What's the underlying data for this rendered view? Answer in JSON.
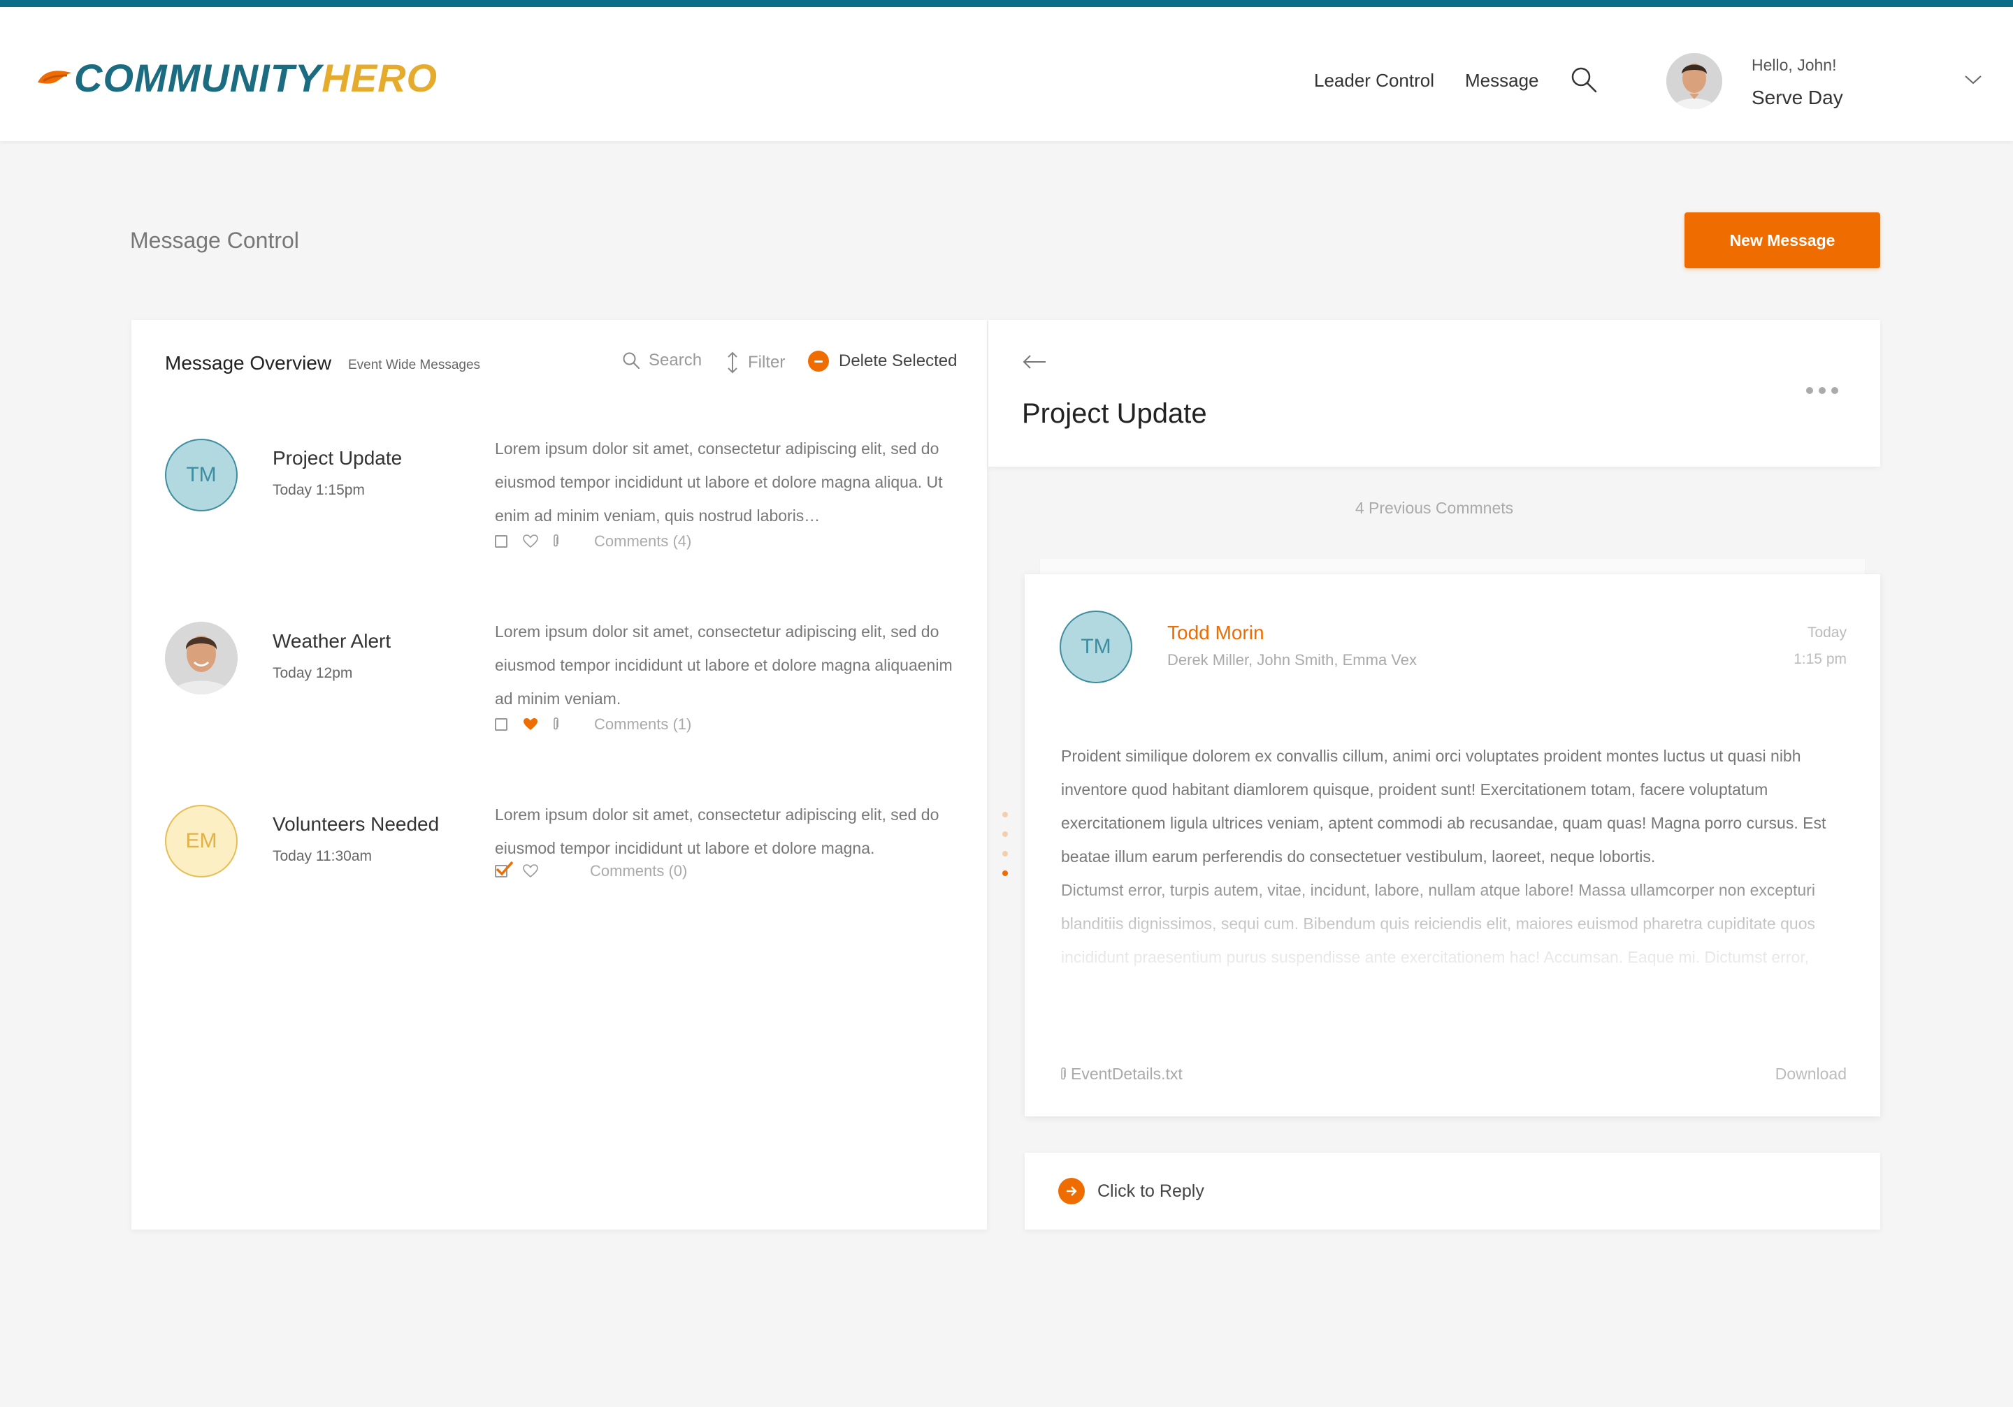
{
  "app": {
    "logo_part1": "COMMUNITY",
    "logo_part2": "HERO",
    "brand_color": "#1b6c80",
    "accent_color": "#ef6c00",
    "logo_gold": "#e5ab2c"
  },
  "nav": {
    "leader_control": "Leader Control",
    "message": "Message",
    "search_icon": "search-icon"
  },
  "user": {
    "greeting": "Hello, John!",
    "event": "Serve Day"
  },
  "page": {
    "title": "Message Control",
    "new_message_label": "New Message"
  },
  "overview": {
    "title": "Message Overview",
    "subtitle": "Event Wide Messages",
    "search_label": "Search",
    "filter_label": "Filter",
    "delete_label": "Delete Selected",
    "messages": [
      {
        "initials": "TM",
        "title": "Project Update",
        "time": "Today 1:15pm",
        "body": "Lorem ipsum dolor sit amet, consectetur adipiscing elit, sed do eiusmod tempor incididunt ut labore et dolore magna aliqua. Ut enim ad minim veniam, quis nostrud laboris…",
        "comments": "Comments (4)",
        "checked": false,
        "liked": false
      },
      {
        "initials": "",
        "title": "Weather Alert",
        "time": "Today 12pm",
        "body": "Lorem ipsum dolor sit amet, consectetur adipiscing elit, sed do eiusmod tempor incididunt ut labore et dolore magna aliquaenim ad minim veniam.",
        "comments": "Comments (1)",
        "checked": false,
        "liked": true
      },
      {
        "initials": "EM",
        "title": "Volunteers Needed",
        "time": "Today 11:30am",
        "body": "Lorem ipsum dolor sit amet, consectetur adipiscing elit, sed do eiusmod tempor incididunt ut labore et dolore magna.",
        "comments": "Comments (0)",
        "checked": true,
        "liked": false
      }
    ]
  },
  "detail": {
    "title": "Project Update",
    "previous_comments": "4 Previous Commnets",
    "card": {
      "initials": "TM",
      "author": "Todd Morin",
      "recipients": "Derek Miller, John Smith, Emma Vex",
      "date": "Today",
      "time": "1:15 pm",
      "body_p1": "Proident similique dolorem ex convallis cillum, animi orci voluptates proident montes luctus ut quasi nibh inventore quod habitant diamlorem quisque, proident sunt! Exercitationem totam, facere voluptatum exercitationem ligula ultrices veniam, aptent commodi ab recusandae, quam quas! Magna porro cursus. Est beatae illum earum perferendis do consectetuer vestibulum, laoreet, neque lobortis.",
      "body_p2": "Dictumst error, turpis autem, vitae, incidunt, labore, nullam atque labore! Massa ullamcorper non excepturi blanditiis dignissimos, sequi cum. Bibendum quis reiciendis elit, maiores euismod pharetra cupiditate quos incididunt praesentium purus suspendisse ante exercitationem hac! Accumsan. Eaque mi. Dictumst error, turpis autem, vitae, incidunt, labore, nullam atque labore!",
      "attachment": "EventDetails.txt",
      "download": "Download"
    },
    "reply_label": "Click to Reply"
  }
}
